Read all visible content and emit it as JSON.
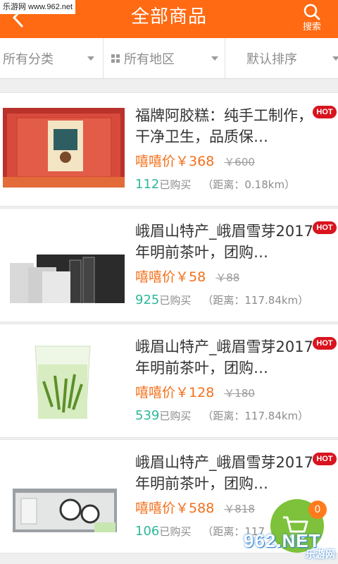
{
  "watermark": {
    "top": "乐游网 www.962.net",
    "bottom_logo": "962.NET",
    "bottom_sub": "乐游网"
  },
  "header": {
    "title": "全部商品",
    "search_label": "搜索"
  },
  "filters": [
    {
      "label": "所有分类"
    },
    {
      "label": "所有地区"
    },
    {
      "label": "默认排序"
    }
  ],
  "products": [
    {
      "title": "福牌阿胶糕：纯手工制作，干净卫生，品质保…",
      "badge": "HOT",
      "price_label": "嘻嘻价",
      "price": "￥368",
      "old_price": "￥600",
      "sold": "112",
      "sold_label": "已购买",
      "distance": "（距离：0.18km）"
    },
    {
      "title": "峨眉山特产_峨眉雪芽2017年明前茶叶，团购…",
      "badge": "HOT",
      "price_label": "嘻嘻价",
      "price": "￥58",
      "old_price": "￥88",
      "sold": "925",
      "sold_label": "已购买",
      "distance": "（距离：117.84km）"
    },
    {
      "title": "峨眉山特产_峨眉雪芽2017年明前茶叶，团购…",
      "badge": "HOT",
      "price_label": "嘻嘻价",
      "price": "￥128",
      "old_price": "￥180",
      "sold": "539",
      "sold_label": "已购买",
      "distance": "（距离：117.84km）"
    },
    {
      "title": "峨眉山特产_峨眉雪芽2017年明前茶叶，团购…",
      "badge": "HOT",
      "price_label": "嘻嘻价",
      "price": "￥588",
      "old_price": "￥818",
      "sold": "106",
      "sold_label": "已购买",
      "distance": "（距离：117"
    }
  ],
  "cart": {
    "count": "0",
    "icon": "cart-icon"
  },
  "colors": {
    "accent": "#ff6a12",
    "price": "#f3701b",
    "sold": "#2cb89a",
    "hot": "#d9141f",
    "cart": "#7dc23a"
  }
}
